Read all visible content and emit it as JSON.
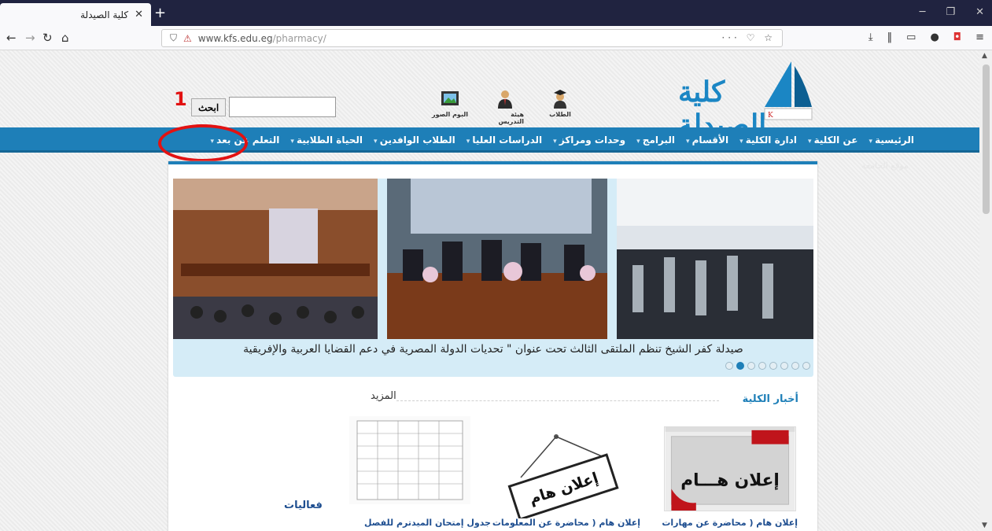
{
  "browser": {
    "tab_title": "كلية الصيدلة",
    "url_domain": "www.kfs.edu.eg",
    "url_path": "/pharmacy/",
    "url_actions": "··· ♡ ☆"
  },
  "header": {
    "logo_text": "كلية الصيدلة",
    "quick_links": [
      {
        "label": "الطلاب",
        "icon": "student-icon"
      },
      {
        "label": "هيئة التدريس",
        "icon": "staff-icon"
      },
      {
        "label": "البوم الصور",
        "icon": "photo-album-icon"
      }
    ],
    "search_button": "ابحث",
    "search_placeholder": ""
  },
  "menu": {
    "items": [
      "الرئيسية",
      "عن الكلية",
      "ادارة الكلية",
      "الأقسام",
      "البرامج",
      "وحدات ومراكز",
      "الدراسات العليا",
      "الطلاب الوافدين",
      "الحياة الطلابية",
      "التعلم عن بعد"
    ],
    "faint_item": "موقع الجامعة"
  },
  "annotation": {
    "number": "1",
    "ring_color": "#e21212"
  },
  "slider": {
    "caption": "صيدلة كفر الشيخ تنظم الملتقى الثالث تحت عنوان \" تحديات الدولة المصرية في دعم القضايا العربية والإفريقية",
    "dot_count": 8,
    "active_dot": 1
  },
  "news": {
    "section_title": "أخبار الكلية",
    "more_label": "المزيد",
    "cards": [
      {
        "title": "إعلان هام ( محاضرة عن مهارات",
        "image_text": "إعلان هـــام"
      },
      {
        "title": "إعلان هام ( محاضرة عن المعلومات",
        "image_text": "إعلان هام"
      },
      {
        "title": "جدول إمتحان الميدترم للفصل الدراسي الثاني من العام الجامعي",
        "image_text": ""
      }
    ],
    "events_label": "فعاليات"
  },
  "colors": {
    "accent": "#1e7fb8",
    "dark_nav": "#202340"
  }
}
